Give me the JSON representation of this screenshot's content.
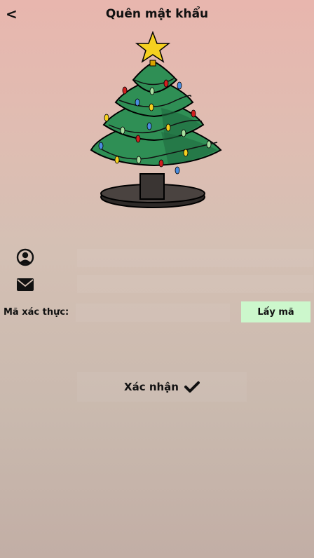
{
  "header": {
    "back_label": "<",
    "title": "Quên mật khẩu"
  },
  "form": {
    "user_icon": "user-circle-icon",
    "email_icon": "envelope-icon",
    "code_label": "Mã xác thực:",
    "get_code_label": "Lấy mã",
    "confirm_label": "Xác nhận",
    "confirm_icon": "check-icon"
  },
  "colors": {
    "get_code_bg": "#ccf7cc",
    "tree_green": "#2e8b57",
    "star": "#f5d020"
  }
}
